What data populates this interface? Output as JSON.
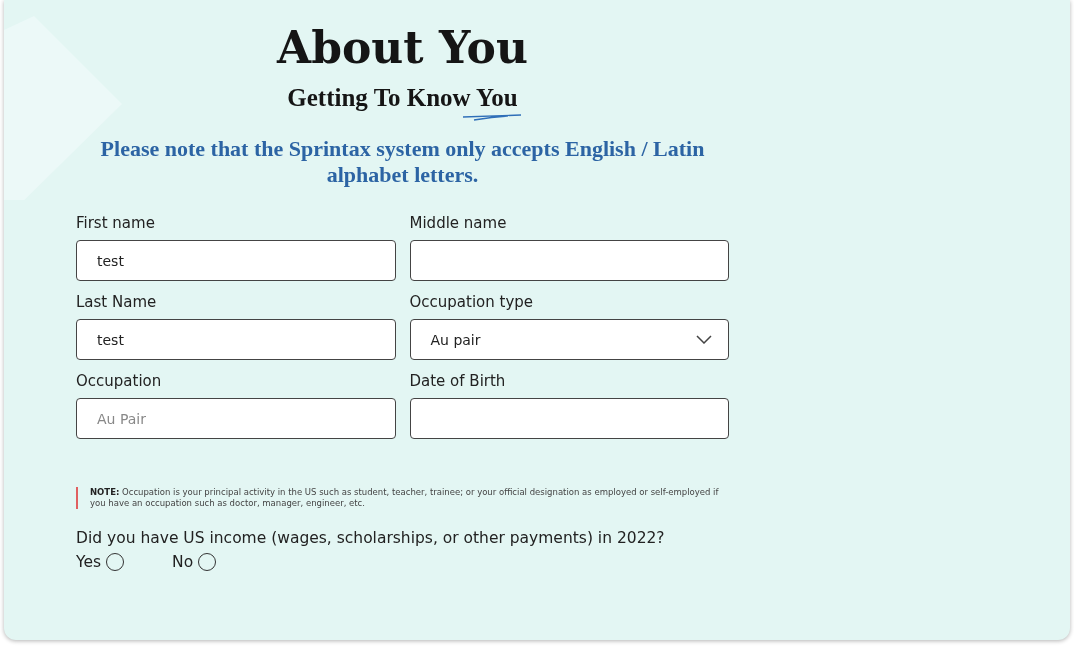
{
  "heading": {
    "title": "About You",
    "subtitle": "Getting To Know You"
  },
  "notice": "Please note that the Sprintax system only accepts English / Latin alphabet letters.",
  "fields": [
    {
      "label": "First name",
      "kind": "text",
      "value": "test"
    },
    {
      "label": "Middle name",
      "kind": "text"
    },
    {
      "label": "Last Name",
      "kind": "text",
      "value": "test"
    },
    {
      "label": "Occupation type",
      "kind": "select",
      "value": "Au pair"
    },
    {
      "label": "Occupation",
      "kind": "text",
      "placeholder": "Au Pair"
    },
    {
      "label": "Date of Birth",
      "kind": "text"
    }
  ],
  "note": "**NOTE:** Occupation is your principal activity in the US such as student, teacher, trainee; or your official designation as employed or self-employed if you have an occupation such as doctor, manager, engineer, etc.",
  "question": {
    "text": "Did you have US income (wages, scholarships, or other payments) in 2022?",
    "options": [
      {
        "label": "Yes",
        "selected": false
      },
      {
        "label": "No",
        "selected": false
      }
    ]
  }
}
